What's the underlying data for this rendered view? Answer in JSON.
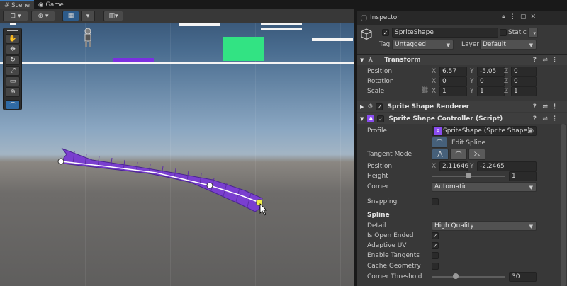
{
  "tabs": {
    "scene": "Scene",
    "game": "Game"
  },
  "toolbar": {
    "draw_mode": "⊡",
    "gizmo": "⊕",
    "grid": "▦",
    "snap": "▥"
  },
  "tools": [
    "hand",
    "move",
    "rotate",
    "scale",
    "rect",
    "transform",
    "spline-edit"
  ],
  "inspector": {
    "tab_title": "Inspector",
    "object_name": "SpriteShape",
    "static_label": "Static",
    "tag_label": "Tag",
    "tag_value": "Untagged",
    "layer_label": "Layer",
    "layer_value": "Default"
  },
  "transform": {
    "title": "Transform",
    "position_label": "Position",
    "rotation_label": "Rotation",
    "scale_label": "Scale",
    "axis_x": "X",
    "axis_y": "Y",
    "axis_z": "Z",
    "position": {
      "x": "6.57",
      "y": "-5.05",
      "z": "0"
    },
    "rotation": {
      "x": "0",
      "y": "0",
      "z": "0"
    },
    "scale": {
      "x": "1",
      "y": "1",
      "z": "1"
    }
  },
  "renderer": {
    "title": "Sprite Shape Renderer"
  },
  "controller": {
    "title": "Sprite Shape Controller (Script)",
    "profile_label": "Profile",
    "profile_value": "SpriteShape (Sprite Shape)",
    "edit_spline_label": "Edit Spline",
    "tangent_mode_label": "Tangent Mode",
    "position_label": "Position",
    "pos_x": "2.11646",
    "pos_y": "-2.2465",
    "height_label": "Height",
    "height_value": "1",
    "height_fraction": 0.5,
    "corner_label": "Corner",
    "corner_value": "Automatic",
    "snapping_label": "Snapping",
    "spline_header": "Spline",
    "detail_label": "Detail",
    "detail_value": "High Quality",
    "open_ended_label": "Is Open Ended",
    "open_ended": true,
    "adaptive_uv_label": "Adaptive UV",
    "adaptive_uv": true,
    "enable_tangents_label": "Enable Tangents",
    "enable_tangents": false,
    "cache_geometry_label": "Cache Geometry",
    "cache_geometry": false,
    "corner_threshold_label": "Corner Threshold",
    "corner_threshold_value": "30",
    "corner_threshold_fraction": 0.33
  },
  "colors": {
    "purple": "#7b2fe0",
    "green": "#32e383",
    "accent": "#3a79bb"
  }
}
